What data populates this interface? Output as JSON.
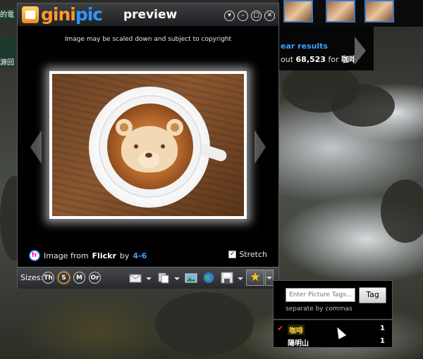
{
  "window": {
    "logo_gini": "gini",
    "logo_pic": "pic",
    "title": "preview",
    "notice": "Image may be scaled down and subject to copyright"
  },
  "credit": {
    "source_icon": "fr",
    "prefix": "Image from",
    "source": "Flickr",
    "by": "by",
    "author": "4-6"
  },
  "stretch": {
    "label": "Stretch",
    "checked": true
  },
  "toolbar": {
    "sizes_label": "Sizes:",
    "sizes": [
      {
        "label": "Th",
        "active": false
      },
      {
        "label": "S",
        "active": true
      },
      {
        "label": "M",
        "active": false
      },
      {
        "label": "Or",
        "active": false
      }
    ],
    "icons": [
      "envelope-icon",
      "copy-icon",
      "image-icon",
      "globe-icon",
      "save-icon",
      "star-icon"
    ]
  },
  "results": {
    "clear": "ear results",
    "count_prefix": "out",
    "count": "68,523",
    "for": "for",
    "query": "咖啡"
  },
  "desktop_labels": [
    "的電",
    "源回收"
  ],
  "tag_popup": {
    "placeholder": "Enter Picture Tags...",
    "button": "Tag",
    "hint": "separate by commas"
  },
  "tags": [
    {
      "name": "咖啡",
      "count": "1",
      "checked": true
    },
    {
      "name": "陽明山",
      "count": "1",
      "checked": false
    }
  ],
  "colors": {
    "accent_blue": "#39a3ff",
    "logo_orange": "#ff9a2a",
    "star": "#ffc21a"
  }
}
